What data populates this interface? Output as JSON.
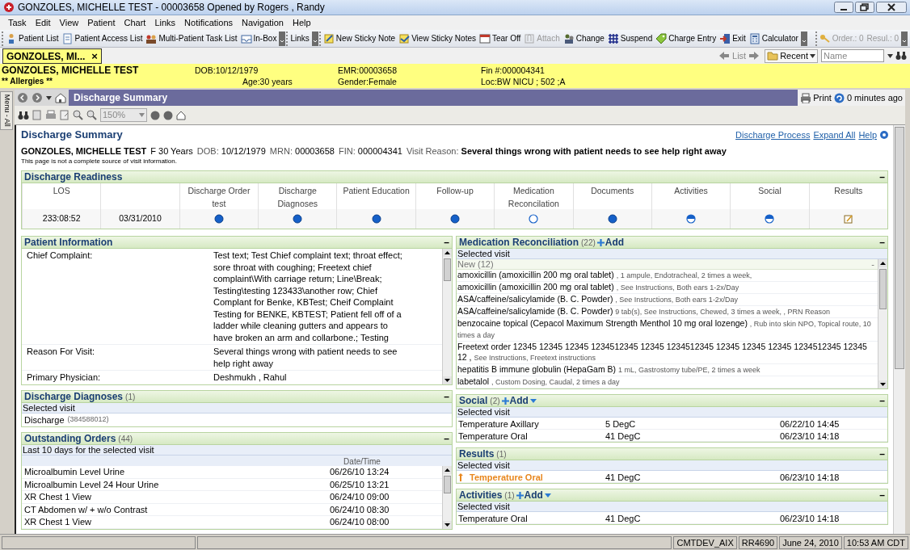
{
  "window": {
    "title": "GONZOLES, MICHELLE TEST - 00003658 Opened by Rogers , Randy"
  },
  "menu": [
    "Task",
    "Edit",
    "View",
    "Patient",
    "Chart",
    "Links",
    "Notifications",
    "Navigation",
    "Help"
  ],
  "toolbar": [
    {
      "items": [
        {
          "label": "Patient List",
          "disabled": false
        },
        {
          "label": "Patient Access List",
          "disabled": false
        },
        {
          "label": "Multi-Patient Task List",
          "disabled": false
        },
        {
          "label": "In-Box",
          "disabled": false
        }
      ]
    },
    {
      "items": [
        {
          "label": "Links",
          "disabled": false
        }
      ]
    },
    {
      "items": [
        {
          "label": "New Sticky Note",
          "disabled": false
        },
        {
          "label": "View Sticky Notes",
          "disabled": false
        },
        {
          "label": "Tear Off",
          "disabled": false
        },
        {
          "label": "Attach",
          "disabled": true
        },
        {
          "label": "Change",
          "disabled": false
        },
        {
          "label": "Suspend",
          "disabled": false
        },
        {
          "label": "Charge Entry",
          "disabled": false
        },
        {
          "label": "Exit",
          "disabled": false
        },
        {
          "label": "Calculator",
          "disabled": false
        }
      ]
    },
    {
      "items": [
        {
          "label": "Order.: 0",
          "disabled": true
        },
        {
          "label": "Resul.: 0",
          "disabled": true
        }
      ]
    }
  ],
  "patient_tab": {
    "label": "GONZOLES, MI...",
    "close": "×"
  },
  "navigation": {
    "list": "List",
    "recent": "Recent",
    "search_placeholder": "Name"
  },
  "banner": {
    "name": "GONZOLES, MICHELLE TEST",
    "allergies": "** Allergies **",
    "dob": "DOB:10/12/1979",
    "age": "Age:30 years",
    "emr": "EMR:00003658",
    "gender": "Gender:Female",
    "fin": "Fin #:000004341",
    "location": "Loc:BW NICU ; 502 ;A"
  },
  "side_tab": "Menu - All",
  "page_header": {
    "title": "Discharge Summary",
    "print": "Print",
    "updated": "0 minutes ago"
  },
  "zoom": "150%",
  "summary": {
    "title": "Discharge Summary",
    "links": [
      "Discharge Process",
      "Expand All",
      "Help"
    ],
    "name": "GONZOLES, MICHELLE TEST",
    "sex_age": "F 30 Years",
    "fields": [
      {
        "label": "DOB:",
        "value": "10/12/1979",
        "bold": false
      },
      {
        "label": "MRN:",
        "value": "00003658",
        "bold": false
      },
      {
        "label": "FIN:",
        "value": "000004341",
        "bold": false
      },
      {
        "label": "Visit Reason:",
        "value": "Several things wrong with patient needs to see help right away",
        "bold": true
      }
    ],
    "note": "This page is not a complete source of visit information."
  },
  "readiness": {
    "title": "Discharge Readiness",
    "collapse": "–",
    "columns": [
      {
        "header": "LOS",
        "kind": "text",
        "value": "233:08:52"
      },
      {
        "kind": "text",
        "value": "03/31/2010"
      },
      {
        "header": "Discharge Order test",
        "kind": "complete"
      },
      {
        "header": "Discharge Diagnoses",
        "kind": "complete"
      },
      {
        "header": "Patient Education",
        "kind": "complete"
      },
      {
        "header": "Follow-up",
        "kind": "complete"
      },
      {
        "header": "Medication Reconcilation",
        "kind": "pending"
      },
      {
        "header": "Documents",
        "kind": "complete"
      },
      {
        "header": "Activities",
        "kind": "partial"
      },
      {
        "header": "Social",
        "kind": "partial"
      },
      {
        "header": "Results",
        "kind": "document"
      }
    ]
  },
  "patient_information": {
    "title": "Patient Information",
    "collapse": "–",
    "rows": [
      {
        "label": "Chief Complaint:",
        "value": "Test text; Test Chief complaint text; throat effect; sore throat with coughing; Freetext chief complaint\\With carriage return; Line\\Break; Testing\\testing 123433\\another row; Chief Complant for Benke, KBTest; Cheif Complaint Testing for BENKE, KBTEST; Patient fell off of a ladder while cleaning gutters and appears to have broken an arm and collarbone.; Testing"
      },
      {
        "label": "Reason For Visit:",
        "value": "Several things wrong with patient needs to see help right away"
      },
      {
        "label": "Primary Physician:",
        "value": "Deshmukh , Rahul"
      }
    ]
  },
  "discharge_diagnoses": {
    "title": "Discharge Diagnoses",
    "count": "(1)",
    "collapse": "–",
    "subtitle": "Selected visit",
    "items": [
      {
        "name": "Discharge",
        "code": "(384588012)"
      }
    ]
  },
  "outstanding_orders": {
    "title": "Outstanding Orders",
    "count": "(44)",
    "collapse": "–",
    "subtitle": "Last 10 days for the selected visit",
    "column": "Date/Time",
    "rows": [
      {
        "name": "Microalbumin Level Urine",
        "date": "06/26/10 13:24"
      },
      {
        "name": "Microalbumin Level 24 Hour Urine",
        "date": "06/25/10 13:21"
      },
      {
        "name": "XR Chest 1 View",
        "date": "06/24/10 09:00"
      },
      {
        "name": "CT Abdomen w/ + w/o Contrast",
        "date": "06/24/10 08:30"
      },
      {
        "name": "XR Chest 1 View",
        "date": "06/24/10 08:00"
      }
    ]
  },
  "medication_reconciliation": {
    "title": "Medication Reconciliation",
    "count": "(22)",
    "add": "Add",
    "add_dropdown": false,
    "collapse": "–",
    "subtitle": "Selected visit",
    "group": "New (12)",
    "group_collapse": "-",
    "rows": [
      {
        "name": "amoxicillin (amoxicillin 200 mg oral tablet)",
        "details": ", 1 ampule, Endotracheal, 2 times a week,"
      },
      {
        "name": "amoxicillin (amoxicillin 200 mg oral tablet)",
        "details": ", See Instructions, Both ears 1-2x/Day"
      },
      {
        "name": "ASA/caffeine/salicylamide (B. C. Powder)",
        "details": ", See Instructions, Both ears 1-2x/Day"
      },
      {
        "name": "ASA/caffeine/salicylamide (B. C. Powder)",
        "details": "9 tab(s), See Instructions, Chewed, 3 times a week, , PRN Reason"
      },
      {
        "name": "benzocaine topical (Cepacol Maximum Strength Menthol 10 mg oral lozenge)",
        "details": ", Rub into skin NPO, Topical route, 10 times a day"
      },
      {
        "name": "Freetext order 12345 12345 12345 1234512345 12345 1234512345 12345 12345 12345 1234512345 12345 12 ,",
        "details": "See Instructions, Freetext instructions"
      },
      {
        "name": "hepatitis B immune globulin (HepaGam B)",
        "details": "1 mL, Gastrostomy tube/PE, 2 times a week"
      },
      {
        "name": "labetalol",
        "details": ", Custom Dosing, Caudal, 2 times a day"
      }
    ]
  },
  "social": {
    "title": "Social",
    "count": "(2)",
    "add": "Add",
    "add_dropdown": true,
    "collapse": "–",
    "subtitle": "Selected visit",
    "rows": [
      {
        "name": "Temperature Axillary",
        "value": "5 DegC",
        "date": "06/22/10 14:45",
        "abnormal": false
      },
      {
        "name": "Temperature Oral",
        "value": "41 DegC",
        "date": "06/23/10 14:18",
        "abnormal": false
      }
    ]
  },
  "results": {
    "title": "Results",
    "count": "(1)",
    "collapse": "–",
    "subtitle": "Selected visit",
    "rows": [
      {
        "name": "Temperature Oral",
        "value": "41 DegC",
        "date": "06/23/10 14:18",
        "abnormal": true
      }
    ]
  },
  "activities": {
    "title": "Activities",
    "count": "(1)",
    "add": "Add",
    "add_dropdown": true,
    "collapse": "–",
    "subtitle": "Selected visit",
    "rows": [
      {
        "name": "Temperature Oral",
        "value": "41 DegC",
        "date": "06/23/10 14:18",
        "abnormal": false
      }
    ]
  },
  "status_bar": [
    "CMTDEV_AIX",
    "RR4690",
    "June 24, 2010",
    "10:53 AM CDT"
  ]
}
